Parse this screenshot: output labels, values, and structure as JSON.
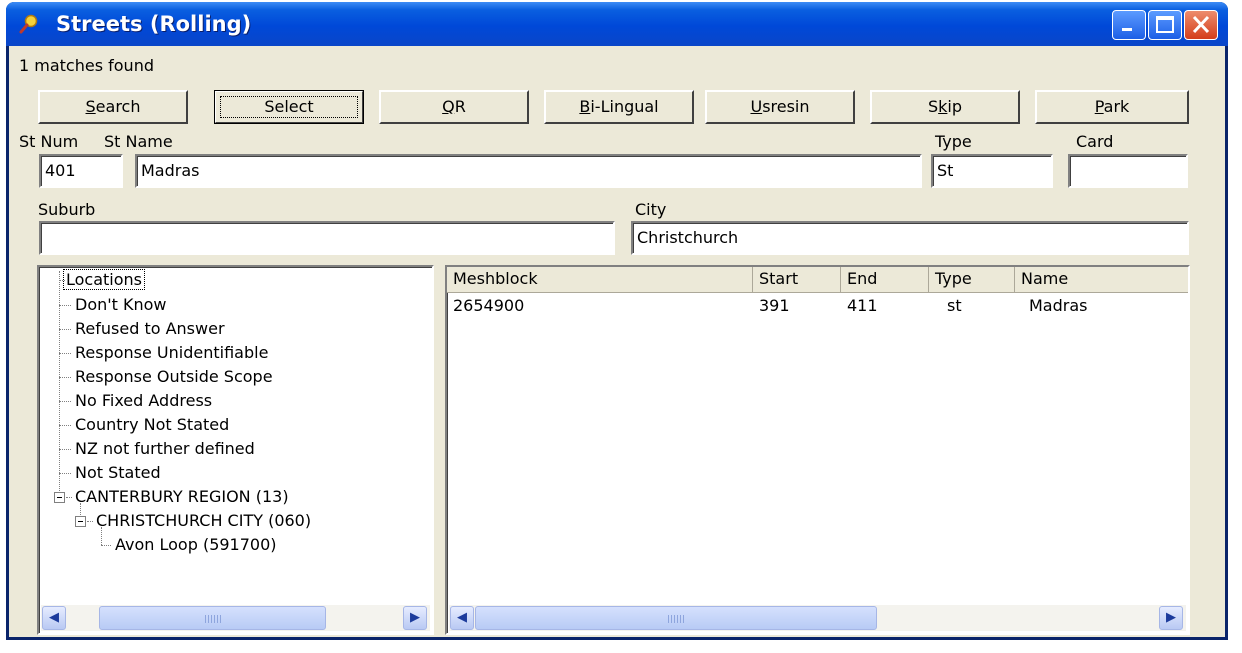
{
  "window": {
    "title": "Streets (Rolling)",
    "icon": "search-icon"
  },
  "status": {
    "matches": "1 matches found"
  },
  "toolbar": {
    "buttons": [
      {
        "pre": "",
        "key": "S",
        "post": "earch"
      },
      {
        "pre": "Select",
        "key": "",
        "post": ""
      },
      {
        "pre": "",
        "key": "Q",
        "post": "R"
      },
      {
        "pre": "",
        "key": "B",
        "post": "i-Lingual"
      },
      {
        "pre": "",
        "key": "U",
        "post": "sresin"
      },
      {
        "pre": "S",
        "key": "k",
        "post": "ip"
      },
      {
        "pre": "",
        "key": "P",
        "post": "ark"
      }
    ]
  },
  "form": {
    "st_num_label": "St Num",
    "st_name_label": "St Name",
    "type_label": "Type",
    "card_label": "Card",
    "suburb_label": "Suburb",
    "city_label": "City",
    "st_num": "401",
    "st_name": "Madras",
    "type": "St",
    "card": "",
    "suburb": "",
    "city": "Christchurch"
  },
  "tree": {
    "root": "Locations",
    "items": [
      "Don't Know",
      "Refused to Answer",
      "Response Unidentifiable",
      "Response Outside Scope",
      "No Fixed Address",
      "Country Not Stated",
      "NZ not further defined",
      "Not Stated",
      "CANTERBURY REGION (13)",
      "CHRISTCHURCH CITY (060)",
      "Avon Loop (591700)"
    ]
  },
  "grid": {
    "columns": [
      "Meshblock",
      "Start",
      "End",
      "Type",
      "Name"
    ],
    "rows": [
      [
        "2654900",
        "391",
        "411",
        "st",
        "Madras"
      ]
    ]
  },
  "colors": {
    "titlebar": "#0048d8",
    "face": "#ece9d8",
    "close": "#d43d1a"
  }
}
